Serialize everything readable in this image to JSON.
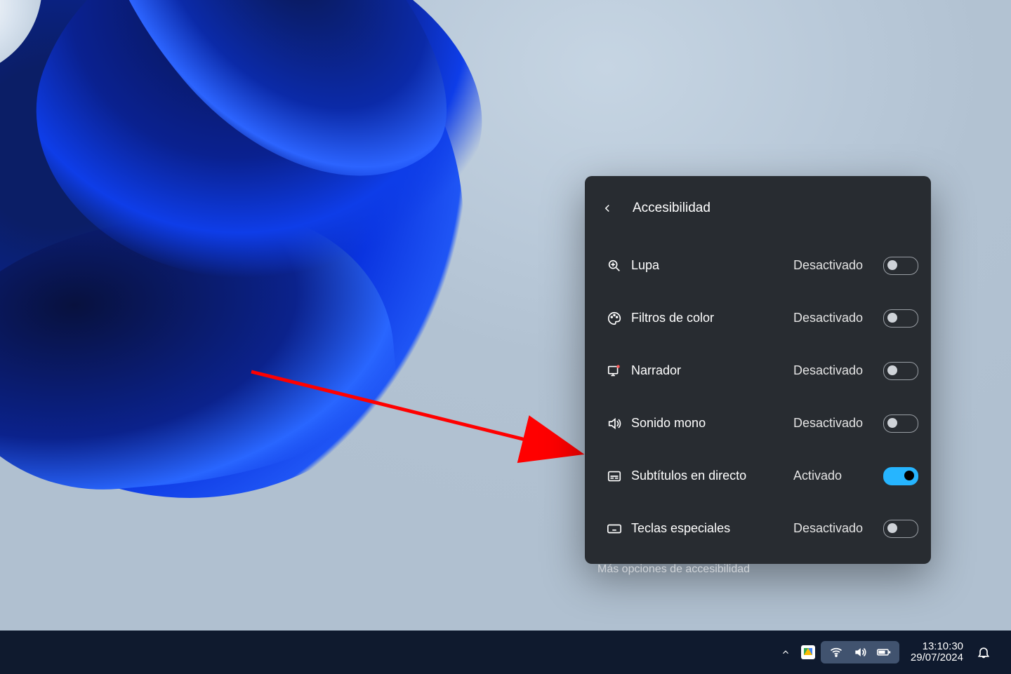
{
  "panel": {
    "title": "Accesibilidad",
    "items": [
      {
        "id": "magnifier",
        "icon": "magnifier-icon",
        "label": "Lupa",
        "status": "Desactivado",
        "on": false
      },
      {
        "id": "colorfilter",
        "icon": "palette-icon",
        "label": "Filtros de color",
        "status": "Desactivado",
        "on": false
      },
      {
        "id": "narrator",
        "icon": "narrator-icon",
        "label": "Narrador",
        "status": "Desactivado",
        "on": false
      },
      {
        "id": "monosound",
        "icon": "speaker-icon",
        "label": "Sonido mono",
        "status": "Desactivado",
        "on": false
      },
      {
        "id": "livecaptions",
        "icon": "captions-icon",
        "label": "Subtítulos en directo",
        "status": "Activado",
        "on": true
      },
      {
        "id": "stickykeys",
        "icon": "keyboard-icon",
        "label": "Teclas especiales",
        "status": "Desactivado",
        "on": false
      }
    ],
    "more_label": "Más opciones de accesibilidad"
  },
  "taskbar": {
    "time": "13:10:30",
    "date": "29/07/2024",
    "tray_icons": [
      "chevron-up-icon",
      "google-drive-icon",
      "wifi-icon",
      "volume-icon",
      "battery-icon"
    ],
    "notification_icon": "bell-icon"
  },
  "annotation_arrow": {
    "color": "#ff0000"
  }
}
